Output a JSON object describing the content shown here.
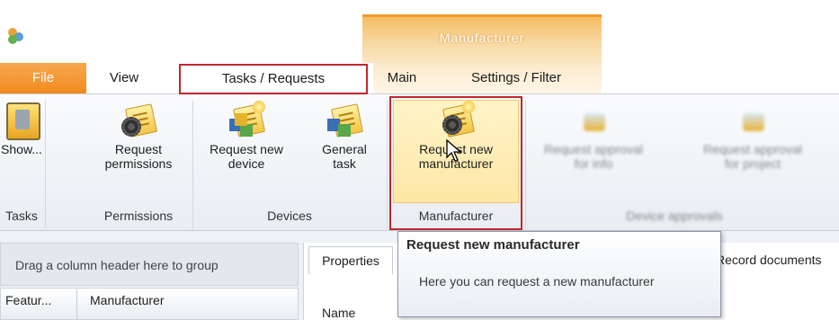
{
  "context_tab": {
    "label": "Manufacturer"
  },
  "tabs": [
    {
      "label": "File"
    },
    {
      "label": "View"
    },
    {
      "label": "Tasks / Requests"
    },
    {
      "label": "Main"
    },
    {
      "label": "Settings / Filter"
    }
  ],
  "ribbon": {
    "buttons": {
      "show": "Show...",
      "request_permissions_1": "Request",
      "request_permissions_2": "permissions",
      "request_new_device_1": "Request new",
      "request_new_device_2": "device",
      "general_task_1": "General",
      "general_task_2": "task",
      "request_new_manufacturer_1": "Request new",
      "request_new_manufacturer_2": "manufacturer",
      "blurred_1a": "Request approval",
      "blurred_1b": "for info",
      "blurred_2a": "Request approval",
      "blurred_2b": "for project"
    },
    "groups": {
      "tasks": "Tasks",
      "permissions": "Permissions",
      "devices": "Devices",
      "manufacturer": "Manufacturer",
      "device_approvals": "Device approvals"
    }
  },
  "lower": {
    "group_panel": "Drag a column header here to group",
    "columns": [
      "Featur...",
      "Manufacturer"
    ],
    "detail_tabs": {
      "properties": "Properties",
      "record_documents": "Record documents"
    },
    "name_label": "Name"
  },
  "tooltip": {
    "title": "Request new manufacturer",
    "body": "Here you can request a new manufacturer"
  },
  "colors": {
    "accent_orange": "#f28a1f",
    "highlight_red": "#c0272d",
    "hover_yellow": "#fde7a5"
  }
}
